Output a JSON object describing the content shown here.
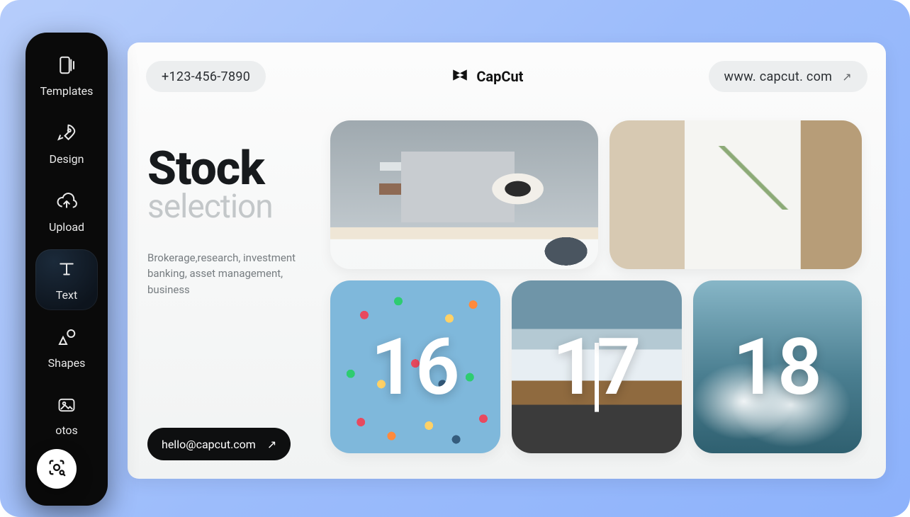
{
  "sidebar": {
    "items": [
      {
        "label": "Templates",
        "icon": "templates"
      },
      {
        "label": "Design",
        "icon": "design"
      },
      {
        "label": "Upload",
        "icon": "upload"
      },
      {
        "label": "Text",
        "icon": "text",
        "active": true
      },
      {
        "label": "Shapes",
        "icon": "shapes"
      },
      {
        "label": "Photos",
        "icon": "photos",
        "visible_label": "otos"
      }
    ]
  },
  "lens_icon": "camera-search",
  "canvas": {
    "header": {
      "phone": "+123-456-7890",
      "brand": "CapCut",
      "website": "www. capcut. com"
    },
    "copy": {
      "title": "Stock",
      "subtitle": "selection",
      "paragraph": "Brokerage,research, investment banking, asset management, business"
    },
    "email_button": {
      "label": "hello@capcut.com"
    },
    "tiles": [
      {
        "id": "t1",
        "kind": "image",
        "subject": "laptop-coffee-work",
        "overlay": null
      },
      {
        "id": "t2",
        "kind": "image",
        "subject": "agenda-notebook-desk",
        "overlay": null
      },
      {
        "id": "t3",
        "kind": "image",
        "subject": "confetti-blue-sky",
        "overlay": "16"
      },
      {
        "id": "t4",
        "kind": "image",
        "subject": "mountain-road",
        "overlay": "17"
      },
      {
        "id": "t5",
        "kind": "image",
        "subject": "ocean-wave",
        "overlay": "18"
      }
    ]
  }
}
